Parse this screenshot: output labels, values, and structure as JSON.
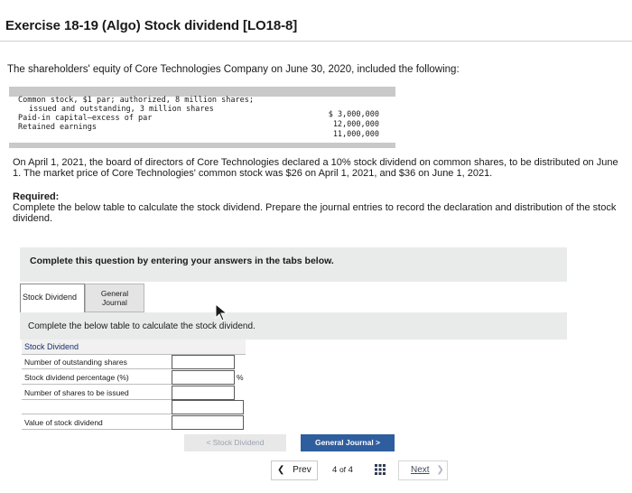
{
  "title": "Exercise 18-19 (Algo) Stock dividend [LO18-8]",
  "intro": "The shareholders' equity of Core Technologies Company on June 30, 2020, included the following:",
  "equity": {
    "rows": [
      {
        "label_line1": "Common stock, $1 par; authorized, 8 million shares;",
        "label_line2": "issued and outstanding, 3 million shares",
        "value": "$ 3,000,000"
      },
      {
        "label": "Paid-in capital—excess of par",
        "value": "12,000,000"
      },
      {
        "label": "Retained earnings",
        "value": "11,000,000"
      }
    ]
  },
  "paragraph": "On April 1, 2021, the board of directors of Core Technologies declared a 10% stock dividend on common shares, to be distributed on June 1. The market price of Core Technologies' common stock was $26 on April 1, 2021, and $36 on June 1, 2021.",
  "required": {
    "title": "Required:",
    "text": "Complete the below table to calculate the stock dividend. Prepare the journal entries to record the declaration and distribution of the stock dividend."
  },
  "instruction": "Complete this question by entering your answers in the tabs below.",
  "tabs": [
    {
      "label": "Stock Dividend"
    },
    {
      "label_line1": "General",
      "label_line2": "Journal"
    }
  ],
  "panel_text": "Complete the below table to calculate the stock dividend.",
  "table": {
    "header": "Stock Dividend",
    "rows": [
      {
        "label": "Number of outstanding shares",
        "value": ""
      },
      {
        "label": "Stock dividend percentage (%)",
        "value": "",
        "suffix": "%"
      },
      {
        "label": "Number of shares to be issued",
        "value": ""
      },
      {
        "label": "",
        "value": ""
      },
      {
        "label": "Value of stock dividend",
        "value": ""
      }
    ]
  },
  "nav": {
    "prev_tab": "< Stock Dividend",
    "next_tab": "General Journal  >"
  },
  "pager": {
    "prev": "Prev",
    "page_current": "4",
    "page_of": "of",
    "page_total": "4",
    "next": "Next"
  }
}
